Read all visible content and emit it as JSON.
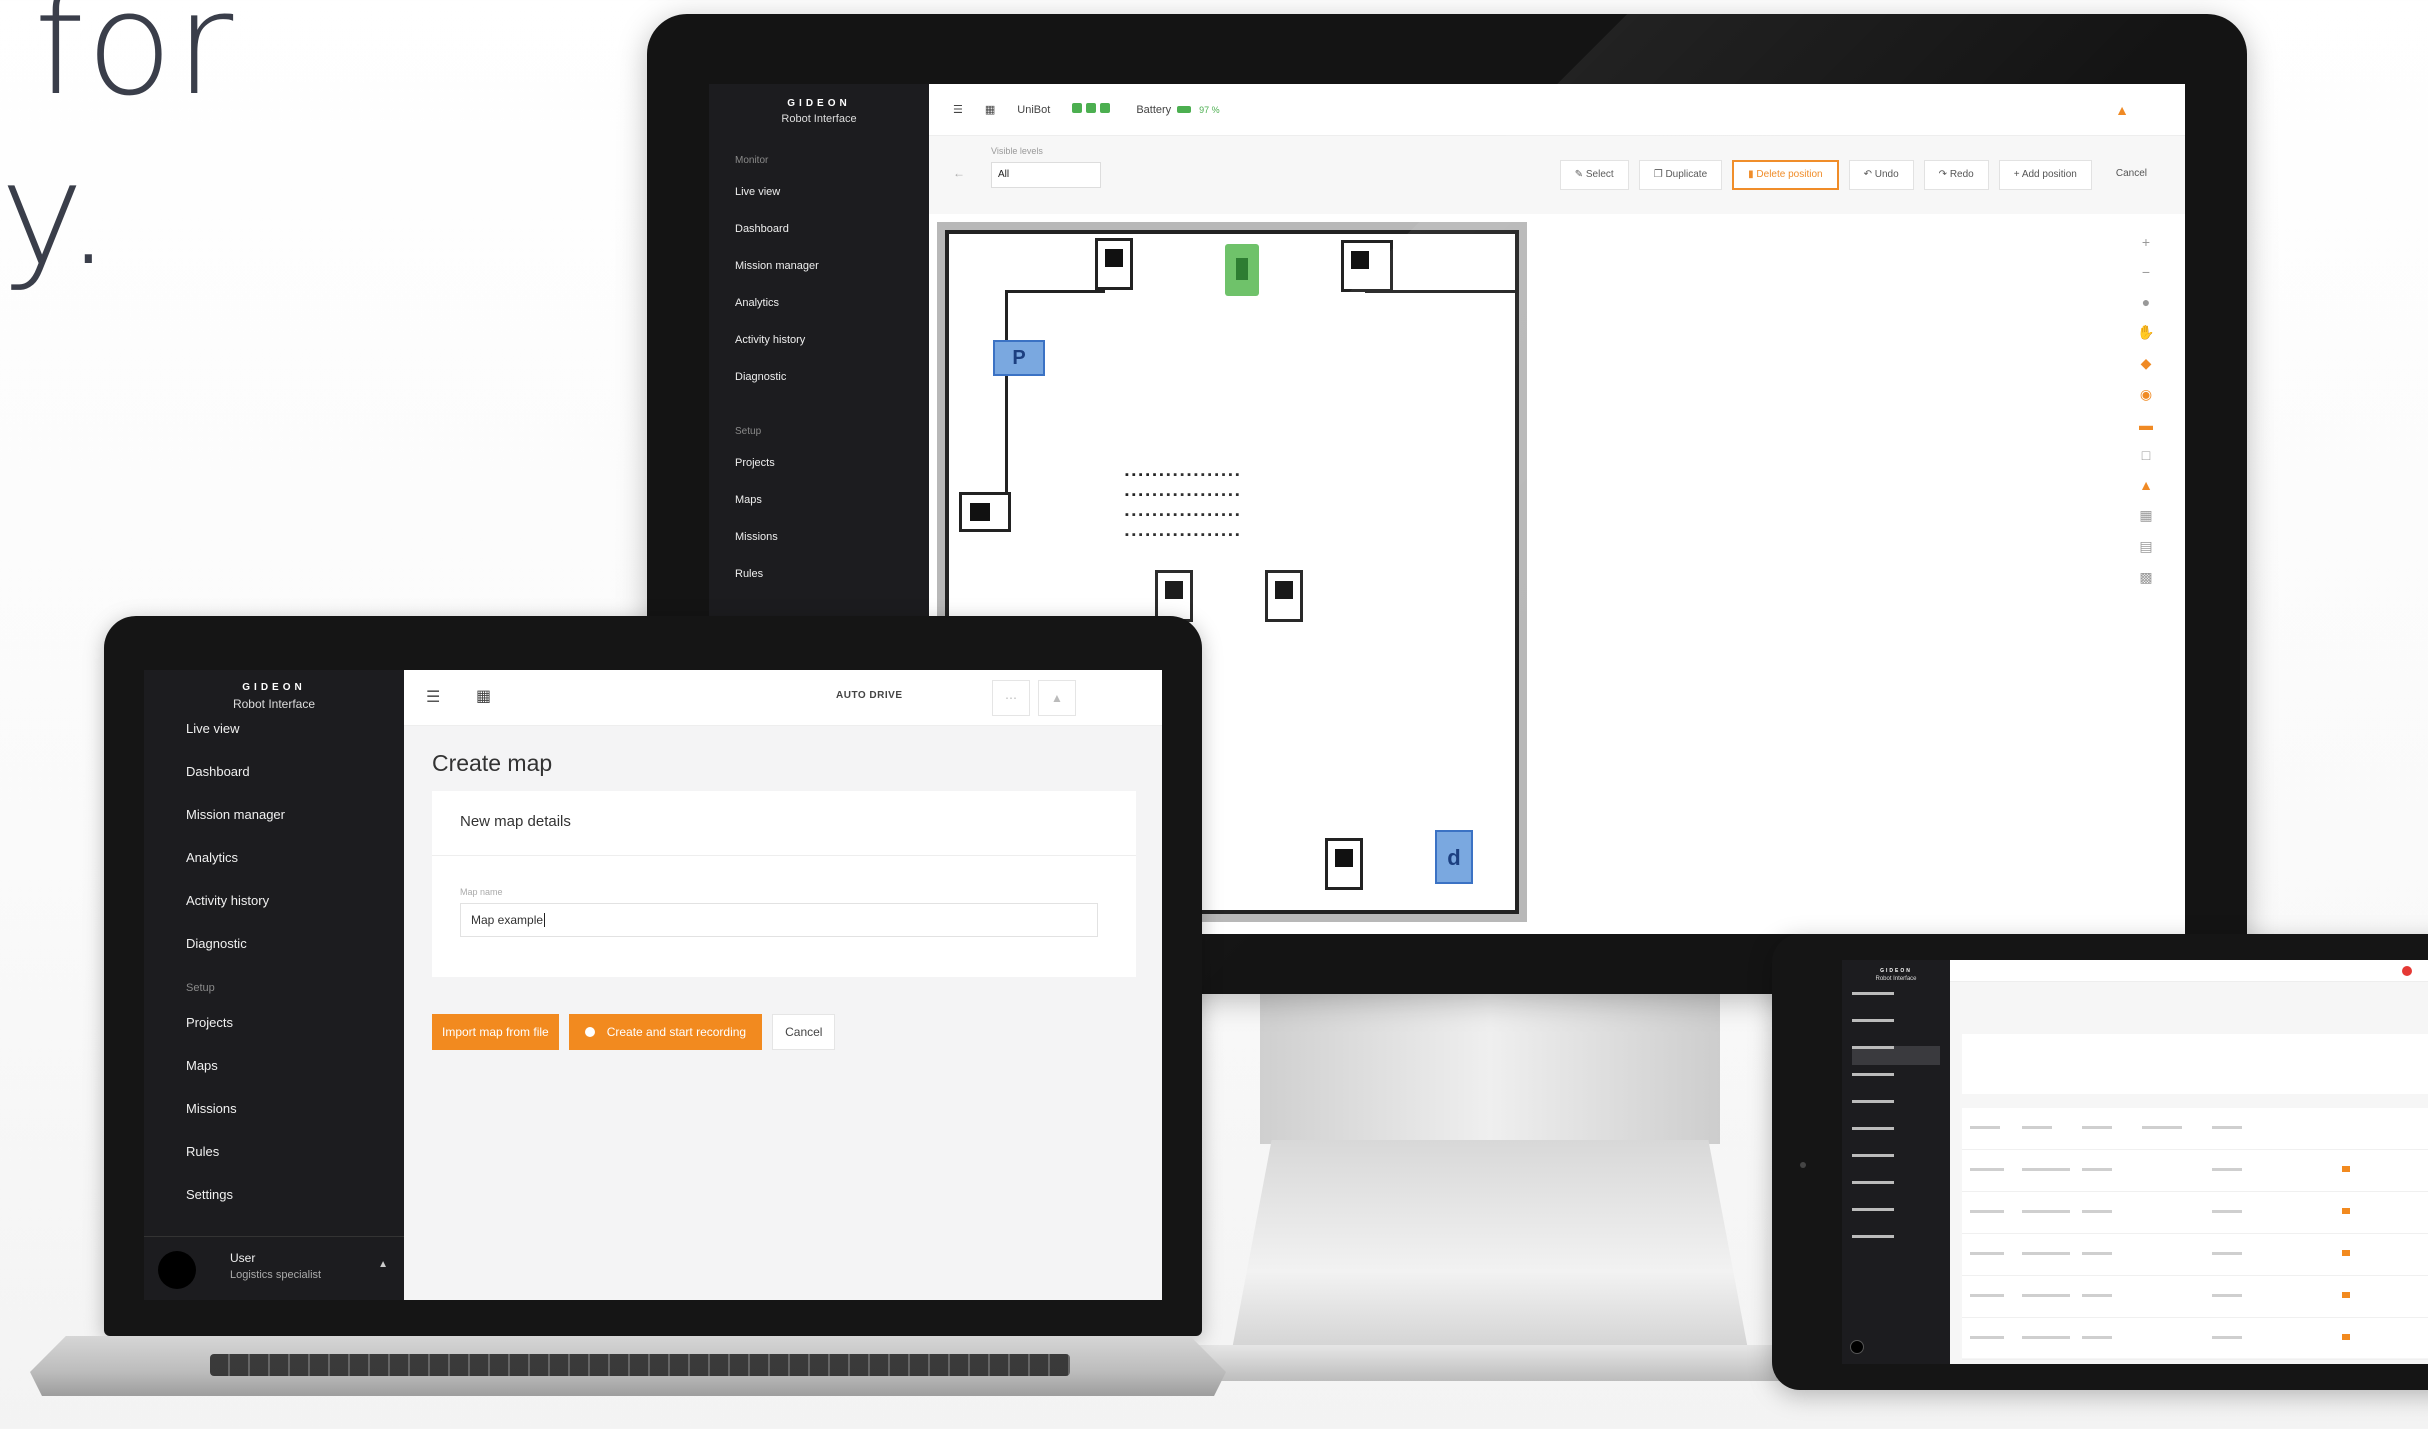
{
  "headline": {
    "line1": "for",
    "line2": "y."
  },
  "brand": {
    "logo": "GIDEON",
    "subtitle": "Robot Interface"
  },
  "desktop": {
    "sidebar": {
      "section_monitor": "Monitor",
      "monitor_items": [
        "Live view",
        "Dashboard",
        "Mission manager",
        "Analytics",
        "Activity history",
        "Diagnostic"
      ],
      "section_setup": "Setup",
      "setup_items": [
        "Projects",
        "Maps",
        "Missions",
        "Rules"
      ]
    },
    "topbar": {
      "robot_name": "UniBot",
      "battery_label": "Battery",
      "battery_value": "97 %"
    },
    "toolbar": {
      "visible_levels_label": "Visible levels",
      "visible_levels_value": "All",
      "buttons": {
        "select": "Select",
        "duplicate": "Duplicate",
        "delete_position": "Delete position",
        "undo": "Undo",
        "redo": "Redo",
        "add_position": "Add position",
        "cancel": "Cancel"
      }
    },
    "map": {
      "marker_p": "P",
      "marker_d": "d"
    }
  },
  "laptop": {
    "sidebar": {
      "monitor_items": [
        "Live view",
        "Dashboard",
        "Mission manager",
        "Analytics",
        "Activity history",
        "Diagnostic"
      ],
      "section_setup": "Setup",
      "setup_items": [
        "Projects",
        "Maps",
        "Missions",
        "Rules",
        "Settings"
      ]
    },
    "user": {
      "name": "User",
      "role": "Logistics specialist"
    },
    "topbar": {
      "mode": "AUTO DRIVE"
    },
    "page_title": "Create map",
    "card_title": "New map details",
    "field_label": "Map name",
    "field_value": "Map example",
    "buttons": {
      "import": "Import map from file",
      "create": "Create and start recording",
      "cancel": "Cancel"
    }
  },
  "colors": {
    "accent": "#f28a1f",
    "sidebar": "#1c1c1f",
    "battery": "#4caf50"
  }
}
